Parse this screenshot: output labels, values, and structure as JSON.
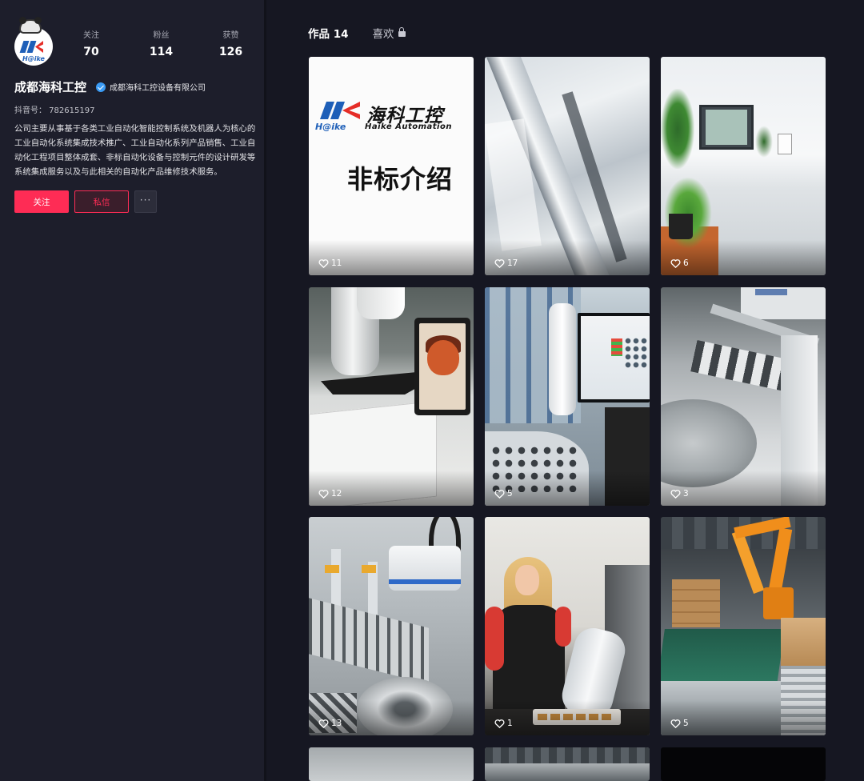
{
  "profile": {
    "avatar_name": "H@ike",
    "stats": [
      {
        "label": "关注",
        "value": "70"
      },
      {
        "label": "粉丝",
        "value": "114"
      },
      {
        "label": "获赞",
        "value": "126"
      }
    ],
    "name": "成都海科工控",
    "company": "成都海科工控设备有限公司",
    "douyin_id": "抖音号： 782615197",
    "bio": "公司主要从事基于各类工业自动化智能控制系统及机器人为核心的工业自动化系统集成技术推广、工业自动化系列产品销售、工业自动化工程项目整体成套、非标自动化设备与控制元件的设计研发等系统集成服务以及与此相关的自动化产品维修技术服务。",
    "actions": {
      "follow": "关注",
      "message": "私信",
      "more": "···"
    },
    "colors": {
      "accent": "#fe2c55",
      "verified": "#3a9bf5",
      "sidebar_bg": "#1d1e2b",
      "page_bg": "#161722"
    }
  },
  "tabs": {
    "works": "作品 14",
    "likes": "喜欢"
  },
  "videos": [
    {
      "likes": "11",
      "logo_cn": "海科工控",
      "logo_en": "Haike Automation",
      "logo_sub": "H@ike",
      "title": "非标介绍"
    },
    {
      "likes": "17"
    },
    {
      "likes": "6"
    },
    {
      "likes": "12"
    },
    {
      "likes": "5"
    },
    {
      "likes": "3"
    },
    {
      "likes": "13"
    },
    {
      "likes": "1"
    },
    {
      "likes": "5"
    }
  ]
}
